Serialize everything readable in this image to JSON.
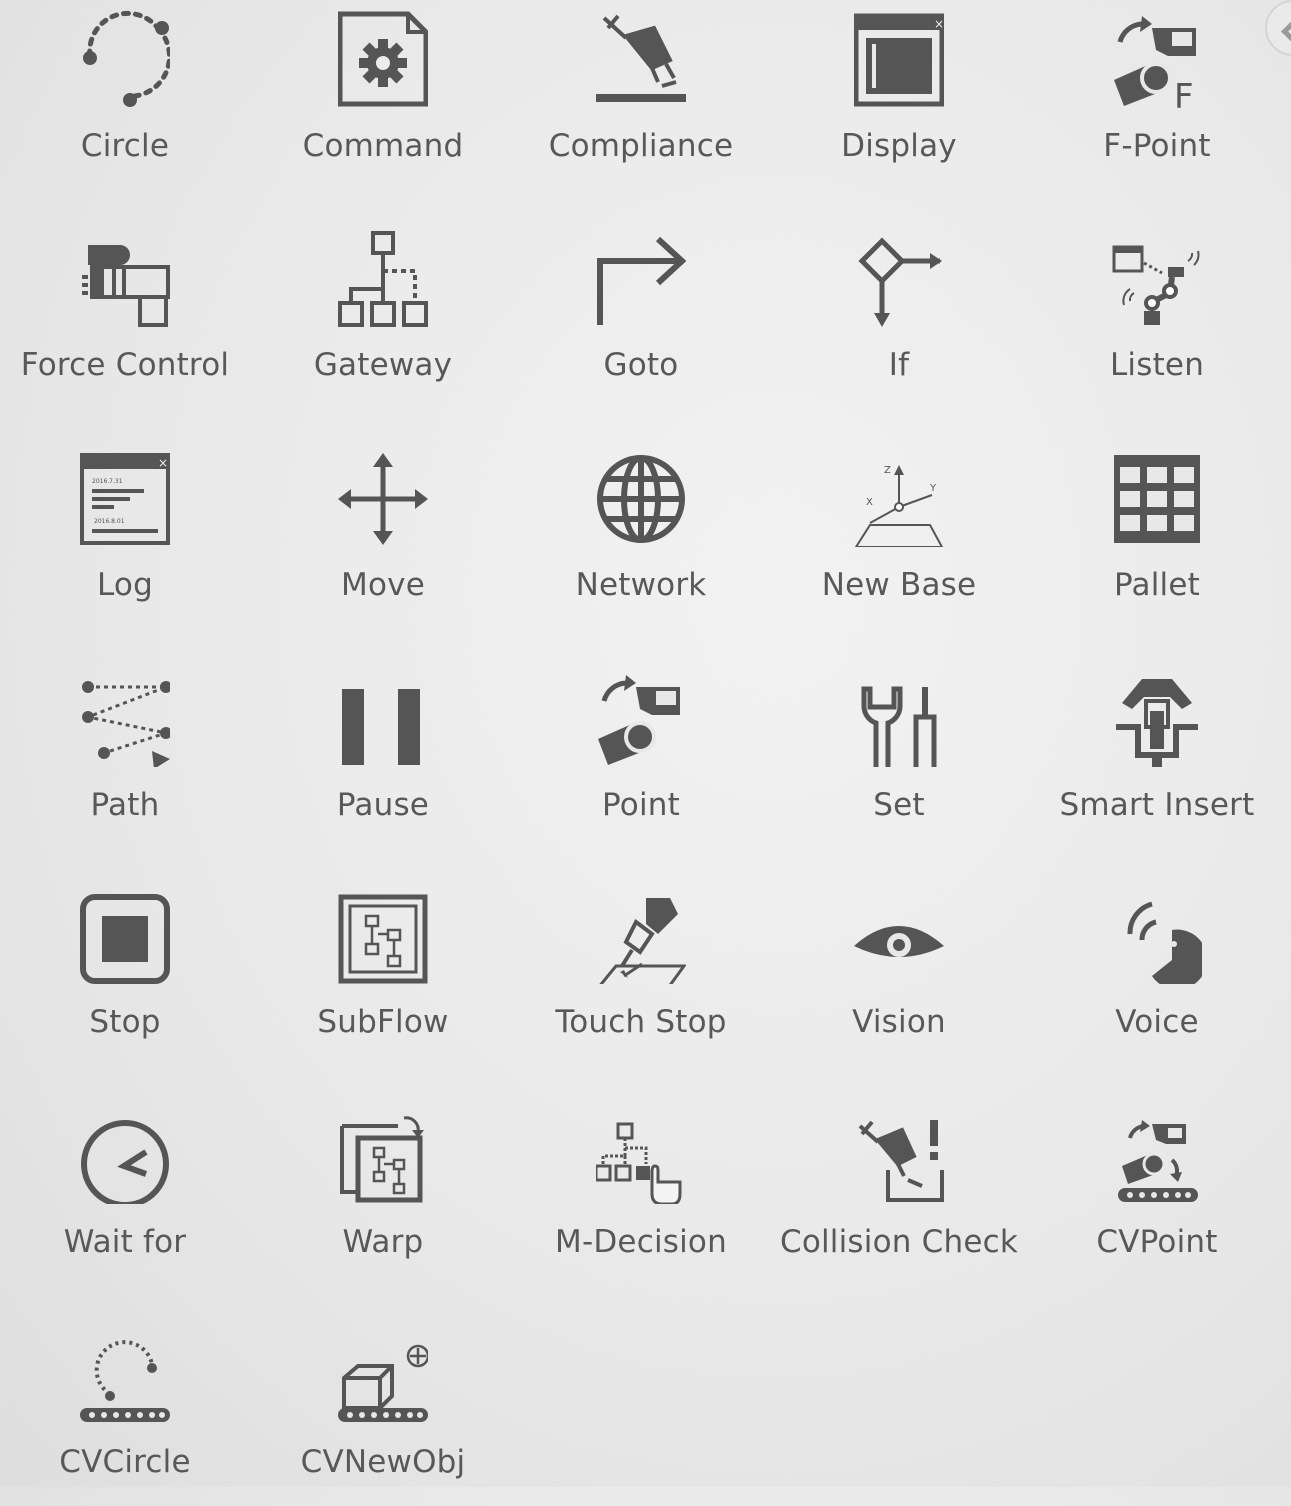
{
  "nodes": [
    {
      "label": "Circle",
      "icon": "circle-icon"
    },
    {
      "label": "Command",
      "icon": "command-icon"
    },
    {
      "label": "Compliance",
      "icon": "compliance-icon"
    },
    {
      "label": "Display",
      "icon": "display-icon"
    },
    {
      "label": "F-Point",
      "icon": "f-point-icon"
    },
    {
      "label": "Force Control",
      "icon": "force-control-icon"
    },
    {
      "label": "Gateway",
      "icon": "gateway-icon"
    },
    {
      "label": "Goto",
      "icon": "goto-icon"
    },
    {
      "label": "If",
      "icon": "if-icon"
    },
    {
      "label": "Listen",
      "icon": "listen-icon"
    },
    {
      "label": "Log",
      "icon": "log-icon"
    },
    {
      "label": "Move",
      "icon": "move-icon"
    },
    {
      "label": "Network",
      "icon": "network-icon"
    },
    {
      "label": "New Base",
      "icon": "new-base-icon"
    },
    {
      "label": "Pallet",
      "icon": "pallet-icon"
    },
    {
      "label": "Path",
      "icon": "path-icon"
    },
    {
      "label": "Pause",
      "icon": "pause-icon"
    },
    {
      "label": "Point",
      "icon": "point-icon"
    },
    {
      "label": "Set",
      "icon": "set-icon"
    },
    {
      "label": "Smart Insert",
      "icon": "smart-insert-icon"
    },
    {
      "label": "Stop",
      "icon": "stop-icon"
    },
    {
      "label": "SubFlow",
      "icon": "subflow-icon"
    },
    {
      "label": "Touch Stop",
      "icon": "touch-stop-icon"
    },
    {
      "label": "Vision",
      "icon": "vision-icon"
    },
    {
      "label": "Voice",
      "icon": "voice-icon"
    },
    {
      "label": "Wait for",
      "icon": "wait-for-icon"
    },
    {
      "label": "Warp",
      "icon": "warp-icon"
    },
    {
      "label": "M-Decision",
      "icon": "m-decision-icon"
    },
    {
      "label": "Collision Check",
      "icon": "collision-check-icon"
    },
    {
      "label": "CVPoint",
      "icon": "cvpoint-icon"
    },
    {
      "label": "CVCircle",
      "icon": "cvcircle-icon"
    },
    {
      "label": "CVNewObj",
      "icon": "cvnewobj-icon"
    }
  ],
  "icon_text": {
    "new_base_z": "Z",
    "new_base_y": "Y",
    "new_base_x": "X",
    "f_point_letter": "F",
    "log_date_1": "2016.7.31",
    "log_date_2": "2016.8.01"
  },
  "colors": {
    "icon": "#555555",
    "label": "#585858",
    "background": "#e9e9e9"
  }
}
